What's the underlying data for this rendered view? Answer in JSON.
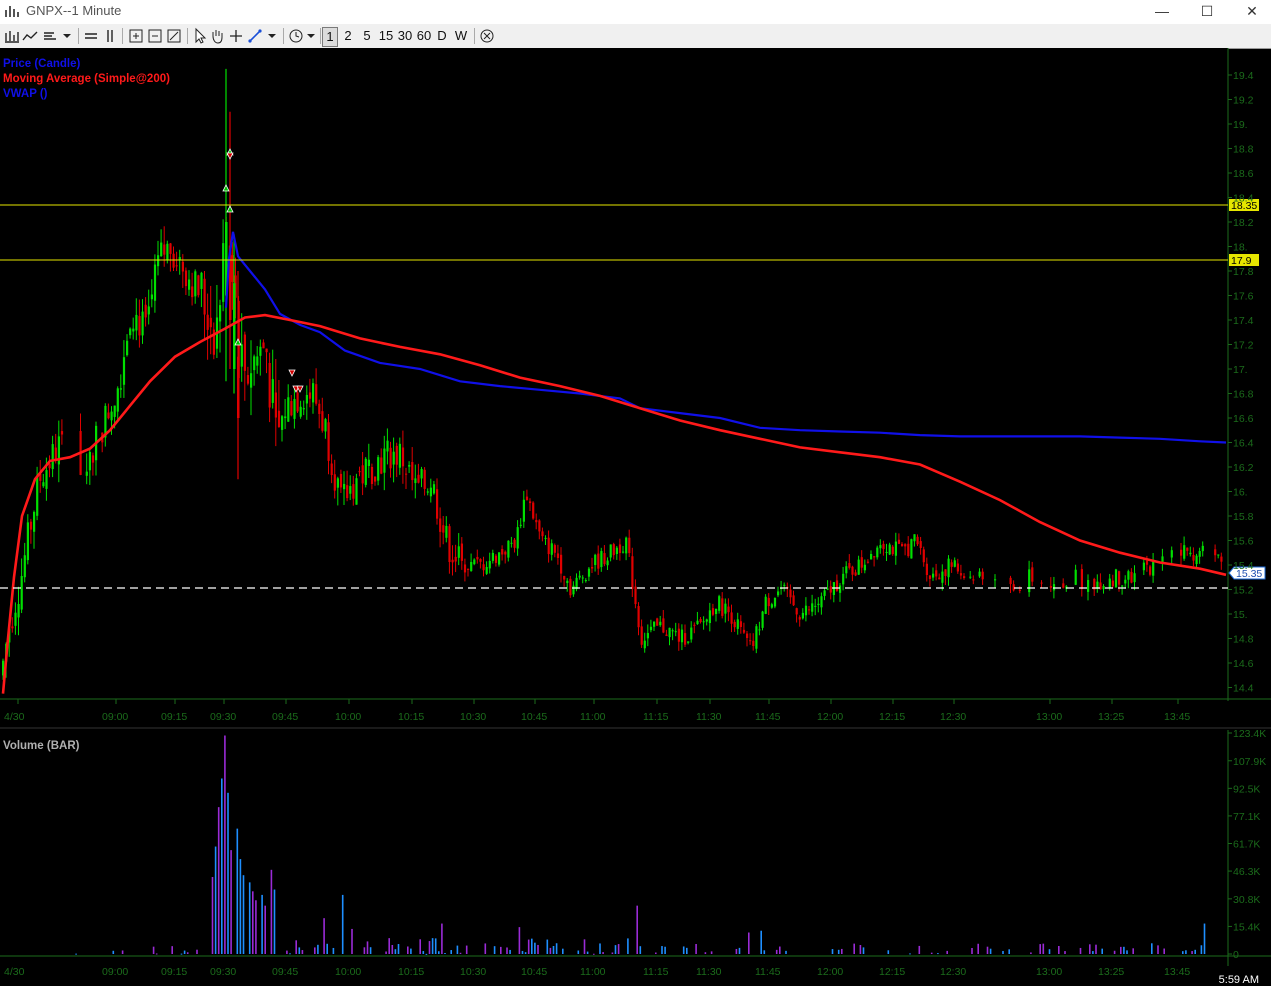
{
  "window": {
    "title": "GNPX--1 Minute",
    "minimize": "—",
    "maximize": "☐",
    "close": "✕"
  },
  "toolbar": {
    "timeframes": [
      "1",
      "2",
      "5",
      "15",
      "30",
      "60",
      "D",
      "W"
    ],
    "icons": [
      "bars-icon",
      "line-chart-icon",
      "chart-type-icon",
      "dropdown-icon",
      "horizontal-lines-icon",
      "vertical-lines-icon",
      "zoom-in-icon",
      "zoom-out-icon",
      "zoom-fit-icon",
      "pointer-icon",
      "hand-icon",
      "crosshair-icon",
      "draw-line-icon",
      "dropdown-icon",
      "clock-icon",
      "dropdown-icon",
      "cancel-icon"
    ]
  },
  "colors": {
    "price_up": "#00e000",
    "price_down": "#e00000",
    "sma": "#ff1a1a",
    "vwap": "#1010e8",
    "level": "#e6e600",
    "axis": "#1b6b1b",
    "vol_blue": "#1e8fff",
    "vol_purple": "#9a2bd6"
  },
  "legend": {
    "price": "Price (Candle)",
    "sma": "Moving Average (Simple@200)",
    "vwap": "VWAP ()"
  },
  "volume_legend": "Volume (BAR)",
  "price_axis_labels": [
    "19.4",
    "19.2",
    "19.",
    "18.8",
    "18.6",
    "18.4",
    "18.2",
    "18.",
    "17.8",
    "17.6",
    "17.4",
    "17.2",
    "17.",
    "16.8",
    "16.6",
    "16.4",
    "16.2",
    "16.",
    "15.8",
    "15.6",
    "15.4",
    "15.2",
    "15.",
    "14.8",
    "14.6",
    "14.4"
  ],
  "volume_axis_labels": [
    "123.4K",
    "107.9K",
    "92.5K",
    "77.1K",
    "61.7K",
    "46.3K",
    "30.8K",
    "15.4K",
    "0"
  ],
  "time_labels": [
    "4/30",
    "09:00",
    "09:15",
    "09:30",
    "09:45",
    "10:00",
    "10:15",
    "10:30",
    "10:45",
    "11:00",
    "11:15",
    "11:30",
    "11:45",
    "12:00",
    "12:15",
    "12:30",
    "13:00",
    "13:25",
    "13:45"
  ],
  "levels": [
    {
      "price": 18.35,
      "label": "18.35"
    },
    {
      "price": 17.9,
      "label": "17.9"
    }
  ],
  "last_price": {
    "price": 15.2,
    "label": "15.35"
  },
  "clock": "5:59 AM",
  "chart_data": [
    {
      "type": "candlestick",
      "title": "GNPX--1 Minute",
      "ylim": [
        14.3,
        19.5
      ],
      "x_ticks": [
        "09:00",
        "09:15",
        "09:30",
        "09:45",
        "10:00",
        "10:15",
        "10:30",
        "10:45",
        "11:00",
        "11:15",
        "11:30",
        "11:45",
        "12:00",
        "12:15",
        "12:30",
        "13:00",
        "13:25",
        "13:45"
      ],
      "series": [
        {
          "name": "Moving Average (Simple@200)",
          "values_approx": [
            14.4,
            15.5,
            16.1,
            16.1,
            16.2,
            16.6,
            16.8,
            16.9,
            16.9,
            16.8,
            16.7,
            16.5,
            16.3,
            16.15,
            16.05,
            15.85,
            15.5,
            15.3
          ]
        },
        {
          "name": "VWAP ()",
          "values_approx": [
            18.1,
            17.6,
            17.35,
            17.15,
            17.0,
            16.85,
            16.65,
            16.55,
            16.5,
            16.45,
            16.45,
            16.4
          ]
        }
      ],
      "horizontal_levels": [
        18.35,
        17.9
      ],
      "last_price": 15.35
    },
    {
      "type": "bar",
      "title": "Volume (BAR)",
      "ylim": [
        0,
        123400
      ],
      "x_ticks": [
        "09:00",
        "09:15",
        "09:30",
        "09:45",
        "10:00",
        "10:15",
        "10:30",
        "10:45",
        "11:00",
        "11:15",
        "11:30",
        "11:45",
        "12:00",
        "12:15",
        "12:30",
        "13:00",
        "13:25",
        "13:45"
      ],
      "peak_volume_approx": 122000
    }
  ]
}
